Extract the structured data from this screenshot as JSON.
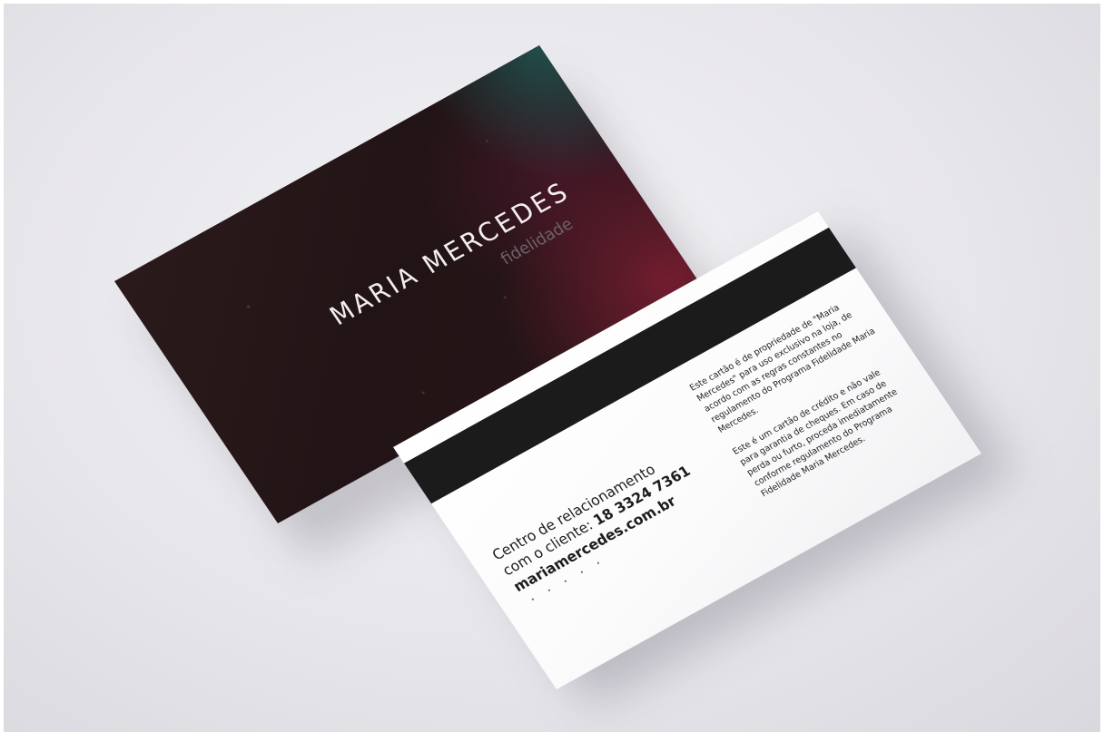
{
  "scene": {
    "background_color": "#e9e8ec",
    "front_card": {
      "title": "MARIA MERCEDES",
      "subtitle": "fidelidade",
      "base_color": "#231517",
      "accent_colors": [
        "#205854",
        "#801e34"
      ]
    },
    "back_card": {
      "strip_color": "#1b1b1c",
      "contact": {
        "line1": "Centro de relacionamento",
        "line2_prefix": "com o cliente: ",
        "phone": "18 3324 7361",
        "website": "mariamercedes.com.br"
      },
      "terms": {
        "paragraph1": "Este cartão é de propriedade de \"Maria Mercedes\" para uso exclusivo na loja, de acordo com as regras constantes no regulamento do Programa Fidelidade Maria Mercedes.",
        "paragraph2": "Este é um cartão de crédito e não vale para garantia de cheques. Em caso de perda ou furto, proceda imediatamente conforme regulamento do Programa Fidelidade Maria Mercedes."
      }
    }
  }
}
